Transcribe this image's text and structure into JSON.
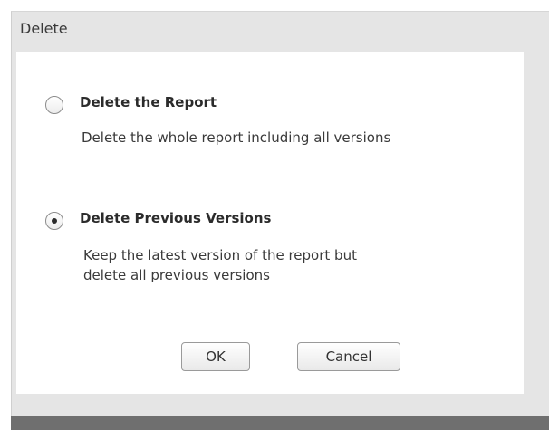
{
  "dialog": {
    "title": "Delete",
    "options": [
      {
        "label": "Delete the Report",
        "description_lines": [
          "Delete the whole report including all versions"
        ],
        "selected": false
      },
      {
        "label": "Delete Previous Versions",
        "description_lines": [
          "Keep the latest version of the report but",
          "delete all previous versions"
        ],
        "selected": true
      }
    ],
    "buttons": {
      "ok_label": "OK",
      "cancel_label": "Cancel"
    }
  }
}
